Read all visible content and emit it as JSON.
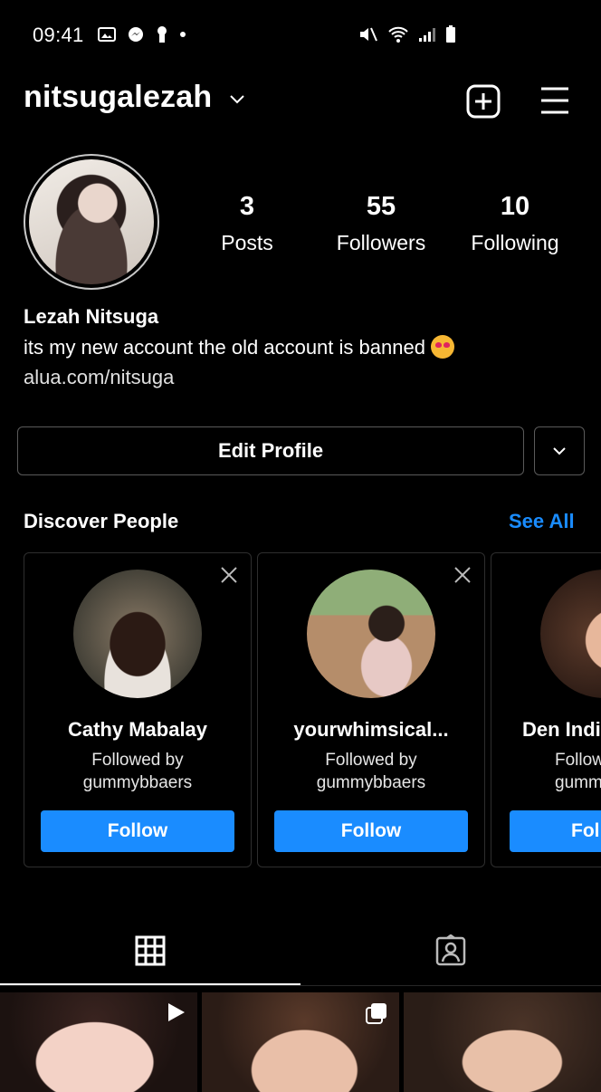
{
  "status_bar": {
    "time": "09:41"
  },
  "header": {
    "username": "nitsugalezah"
  },
  "profile": {
    "stats": [
      {
        "value": "3",
        "label": "Posts"
      },
      {
        "value": "55",
        "label": "Followers"
      },
      {
        "value": "10",
        "label": "Following"
      }
    ],
    "full_name": "Lezah Nitsuga",
    "bio": "its my new account the old account is banned",
    "link": "alua.com/nitsuga",
    "edit_button": "Edit Profile"
  },
  "discover": {
    "title": "Discover People",
    "see_all": "See All",
    "cards": [
      {
        "name": "Cathy Mabalay",
        "followed_by_label": "Followed by",
        "followed_by": "gummybbaers",
        "button": "Follow"
      },
      {
        "name": "yourwhimsical...",
        "followed_by_label": "Followed by",
        "followed_by": "gummybbaers",
        "button": "Follow"
      },
      {
        "name": "Den Indi",
        "followed_by_label": "Follow",
        "followed_by": "gummy",
        "button": "Fol"
      }
    ]
  },
  "tabs": [
    {
      "icon": "grid-icon",
      "active": true
    },
    {
      "icon": "tagged-icon",
      "active": false
    }
  ],
  "colors": {
    "accent": "#1a8cff",
    "background": "#000000",
    "border": "#5a5a5a"
  }
}
